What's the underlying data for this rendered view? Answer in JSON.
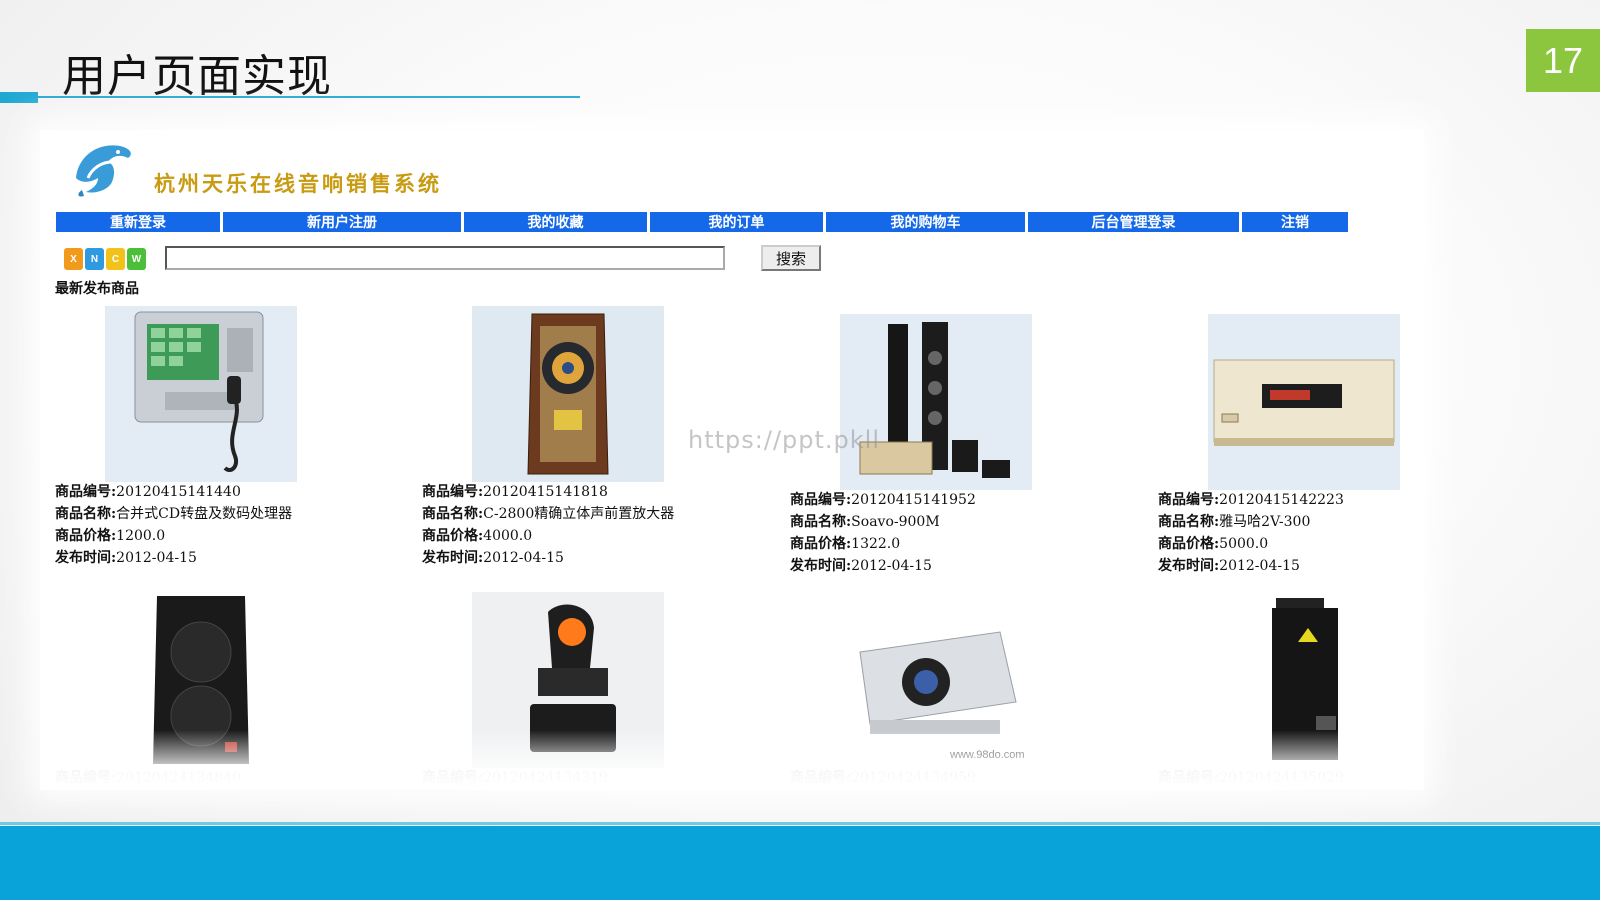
{
  "slide": {
    "title": "用户页面实现",
    "page_number": "17",
    "watermark": "https://ppt.pkll"
  },
  "site": {
    "title": "杭州天乐在线音响销售系统",
    "nav": [
      {
        "label": "重新登录"
      },
      {
        "label": "新用户注册"
      },
      {
        "label": "我的收藏"
      },
      {
        "label": "我的订单"
      },
      {
        "label": "我的购物车"
      },
      {
        "label": "后台管理登录"
      },
      {
        "label": "注销"
      }
    ],
    "search": {
      "logo_letters": [
        "X",
        "N",
        "C",
        "W"
      ],
      "input_value": "",
      "button_label": "搜索"
    },
    "section_heading": "最新发布商品",
    "product_labels": {
      "id": "商品编号:",
      "name": "商品名称:",
      "price": "商品价格:",
      "date": "发布时间:"
    },
    "products": [
      {
        "id": "20120415141440",
        "name": "合并式CD转盘及数码处理器",
        "price": "1200.0",
        "date": "2012-04-15",
        "image": "pa-console-icon"
      },
      {
        "id": "20120415141818",
        "name": "C-2800精确立体声前置放大器",
        "price": "4000.0",
        "date": "2012-04-15",
        "image": "wood-speaker-icon"
      },
      {
        "id": "20120415141952",
        "name": "Soavo-900M",
        "price": "1322.0",
        "date": "2012-04-15",
        "image": "speaker-set-icon"
      },
      {
        "id": "20120415142223",
        "name": "雅马哈2V-300",
        "price": "5000.0",
        "date": "2012-04-15",
        "image": "amplifier-icon"
      },
      {
        "id": "20120424134840",
        "image": "pa-speaker-icon"
      },
      {
        "id": "20120424134319",
        "image": "moving-head-light-icon"
      },
      {
        "id": "20120424134959",
        "image": "projector-icon"
      },
      {
        "id": "20120424135029",
        "image": "fog-machine-icon"
      }
    ]
  }
}
